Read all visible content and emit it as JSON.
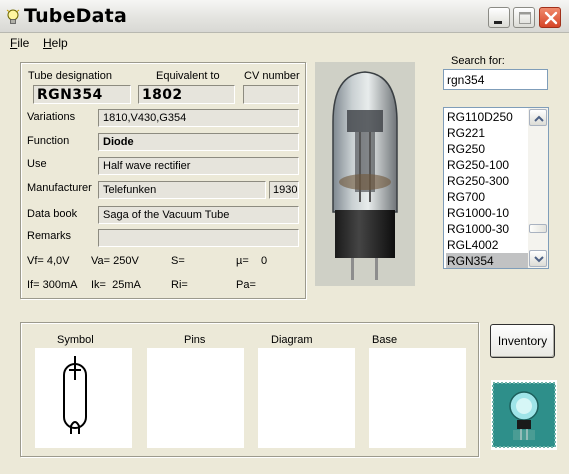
{
  "window": {
    "title": "TubeData",
    "controls": {
      "minimize": "minimize-icon",
      "maximize": "maximize-icon",
      "close": "close-icon"
    }
  },
  "menu": {
    "file_first": "F",
    "file_rest": "ile",
    "help_first": "H",
    "help_rest": "elp"
  },
  "headers": {
    "designation": "Tube designation",
    "equivalent": "Equivalent to",
    "cv": "CV number"
  },
  "tube": {
    "designation": "RGN354",
    "equivalent": "1802",
    "cv": "",
    "variations": "1810,V430,G354",
    "function": "Diode",
    "use": "Half wave rectifier",
    "manufacturer": "Telefunken",
    "year": "1930",
    "data_book": "Saga of the Vacuum Tube",
    "remarks": ""
  },
  "labels": {
    "variations": "Variations",
    "function": "Function",
    "use": "Use",
    "manufacturer": "Manufacturer",
    "data_book": "Data book",
    "remarks": "Remarks"
  },
  "params": {
    "vf": "Vf= 4,0V",
    "va": "Va=  250V",
    "s": "S=",
    "mu": "µ=    0",
    "if": "If= 300mA",
    "ik": "Ik=  25mA",
    "ri": "Ri=",
    "pa": "Pa="
  },
  "search": {
    "label": "Search for:",
    "value": "rgn354",
    "results": [
      "RG110D250",
      "RG221",
      "RG250",
      "RG250-100",
      "RG250-300",
      "RG700",
      "RG1000-10",
      "RG1000-30",
      "RGL4002",
      "RGN354"
    ],
    "selected": "RGN354"
  },
  "bottom": {
    "symbol": "Symbol",
    "pins": "Pins",
    "diagram": "Diagram",
    "base": "Base",
    "inventory_button": "Inventory"
  },
  "colors": {
    "window_bg": "#ece9d8",
    "close_button": "#d64527",
    "selection": "#c1c2c3",
    "logo_bg": "#2e8f8a"
  }
}
